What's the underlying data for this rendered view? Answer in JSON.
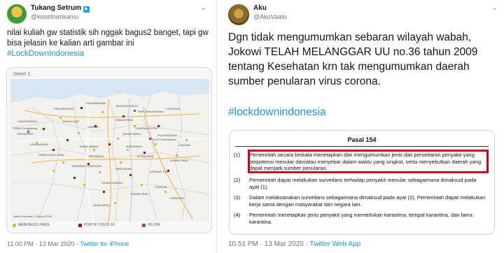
{
  "left_tweet": {
    "display_name": "Tukang Setrum",
    "verified_badge": "▶",
    "handle": "@kesetrumkamu",
    "text": "nilai kuliah gw statistik sih nggak bagus2 banget, tapi gw bisa jelasin ke kalian arti gambar ini",
    "hashtag": "#LockDownIndonesia",
    "timestamp": "11.00 PM · 13 Mar 2020 · ",
    "via": "Twitter for iPhone",
    "map": {
      "sheet_label": "Sheet 1",
      "legend": [
        "MENUNGGU HASIL",
        "POSITIF COVID-19",
        "RS IDH"
      ],
      "legend_colors": [
        "#c9c23a",
        "#a01818",
        "#b03aa8"
      ],
      "labels": [
        "PADEMANGAN",
        "PENJARINGAN",
        "TANJUNG PRIOK",
        "KEMAYORAN",
        "CILINCING",
        "CENGKARENG",
        "KALIDERES",
        "GAMBIR",
        "CEMPAKA PUTIH",
        "KEMBANGAN",
        "TAMAN SARI",
        "JOHAR BARU",
        "PULOGADUNG",
        "CAKUNG",
        "KEBAYORAN LAMA",
        "TANAH ABANG",
        "MATRAMAN",
        "SETIABUDI",
        "JATINEGARA",
        "DUREN SAWIT",
        "MAMPANG PRAPATAN",
        "PANCORAN",
        "KRAMAT JATI",
        "PASAR MINGGU",
        "CIRACAS",
        "PASAR REBO",
        "CIPAYUNG",
        "JAGAKARSA",
        "RSUP Persahabatan",
        "RSUD Cengkareng",
        "RSPI Sulianti Saroso"
      ],
      "footer_note": "Hasil Pemetaan 12 Maret 2020"
    }
  },
  "right_tweet": {
    "display_name": "Aku",
    "handle": "@AkuVaatu",
    "text": "Dgn tidak mengumumkan sebaran wilayah wabah, Jokowi TELAH MELANGGAR UU no.36 tahun 2009 tentang Kesehatan krn tak mengumumkan daerah sumber penularan virus corona.",
    "hashtag": "#lockdownindonesia",
    "timestamp": "10.51 PM · 13 Mar 2020 · ",
    "via": "Twitter Web App",
    "document": {
      "title": "Pasal 154",
      "clauses": [
        {
          "num": "(1)",
          "text": "Pemerintah secara berkala menetapkan dan mengumumkan jenis dan persebaran penyakit yang berpotensi menular dan/atau menyebar dalam waktu yang singkat, serta menyebutkan daerah yang dapat menjadi sumber penularan."
        },
        {
          "num": "(2)",
          "text": "Pemerintah dapat melakukan surveilans terhadap penyakit menular sebagaimana dimaksud pada ayat (1)."
        },
        {
          "num": "(3)",
          "text": "Dalam melaksanakan surveilans sebagaimana dimaksud pada ayat (2), Pemerintah dapat melakukan kerja sama dengan masyarakat dan negara lain."
        },
        {
          "num": "(4)",
          "text": "Pemerintah menetapkan jenis penyakit yang memerlukan karantina, tempat karantina, dan lama karantina."
        }
      ],
      "highlight_color": "#d0021b"
    }
  },
  "icons": {
    "chevron": "⌄"
  }
}
